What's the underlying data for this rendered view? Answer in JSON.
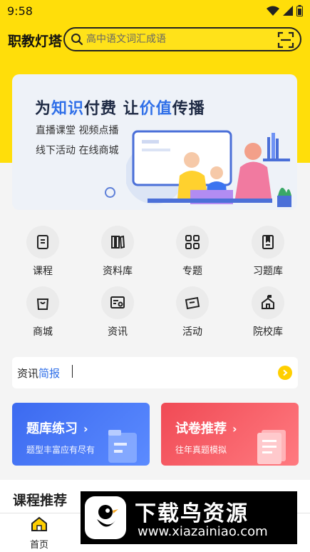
{
  "status_bar": {
    "time": "9:58"
  },
  "header": {
    "app_title": "职教灯塔",
    "search_placeholder": "高中语文词汇成语"
  },
  "banner": {
    "headline_parts": [
      "为",
      "知识",
      "付费 让",
      "价值",
      "传播"
    ],
    "line1": "直播课堂 视频点播",
    "line2": "线下活动 在线商城"
  },
  "grid": [
    {
      "label": "课程",
      "icon": "book-icon"
    },
    {
      "label": "资料库",
      "icon": "books-icon"
    },
    {
      "label": "专题",
      "icon": "grid-icon"
    },
    {
      "label": "习题库",
      "icon": "exercise-book-icon"
    },
    {
      "label": "商城",
      "icon": "shopping-bag-icon"
    },
    {
      "label": "资讯",
      "icon": "news-icon"
    },
    {
      "label": "活动",
      "icon": "ticket-icon"
    },
    {
      "label": "院校库",
      "icon": "school-icon"
    }
  ],
  "news": {
    "label_plain": "资讯",
    "label_blue": "简报"
  },
  "cards": [
    {
      "title": "题库练习",
      "subtitle": "题型丰富应有尽有",
      "color": "#3c6af0"
    },
    {
      "title": "试卷推荐",
      "subtitle": "往年真题模拟",
      "color": "#f04a55"
    }
  ],
  "section": {
    "title": "课程推荐"
  },
  "tabbar": {
    "home_label": "首页"
  },
  "watermark": {
    "title": "下载鸟资源",
    "url": "www.xiazainiao.com"
  },
  "colors": {
    "brand_yellow": "#ffde0a",
    "accent_blue": "#2f6fe8"
  }
}
